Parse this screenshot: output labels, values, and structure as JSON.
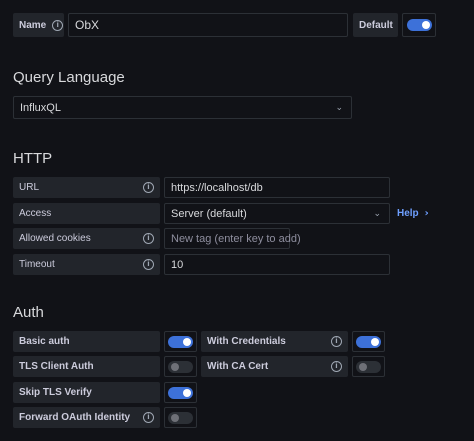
{
  "name_row": {
    "label": "Name",
    "value": "ObX",
    "default_label": "Default",
    "default_on": true
  },
  "query_language": {
    "heading": "Query Language",
    "selected": "InfluxQL"
  },
  "http": {
    "heading": "HTTP",
    "url_label": "URL",
    "url_value": "https://localhost/db",
    "access_label": "Access",
    "access_value": "Server (default)",
    "help_label": "Help",
    "allowed_cookies_label": "Allowed cookies",
    "allowed_cookies_placeholder": "New tag (enter key to add)",
    "timeout_label": "Timeout",
    "timeout_value": "10"
  },
  "auth": {
    "heading": "Auth",
    "basic_auth_label": "Basic auth",
    "basic_auth_on": true,
    "with_credentials_label": "With Credentials",
    "with_credentials_on": true,
    "tls_client_auth_label": "TLS Client Auth",
    "tls_client_auth_on": false,
    "with_ca_cert_label": "With CA Cert",
    "with_ca_cert_on": false,
    "skip_tls_verify_label": "Skip TLS Verify",
    "skip_tls_verify_on": true,
    "forward_oauth_label": "Forward OAuth Identity",
    "forward_oauth_on": false
  },
  "colors": {
    "background": "#111217",
    "label_bg": "#22252b",
    "accent": "#3d71d9",
    "link": "#6e9fff"
  }
}
